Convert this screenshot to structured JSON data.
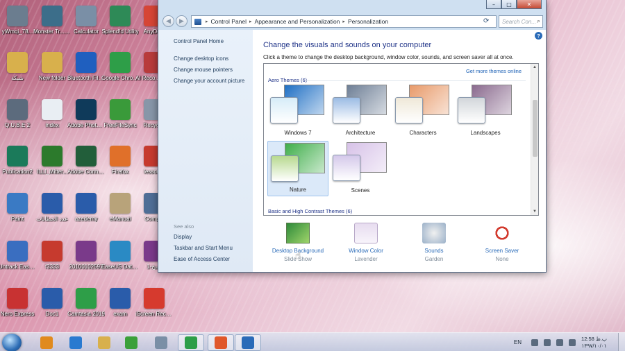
{
  "desktop_icons": [
    {
      "label": "yWmqi_78...",
      "icon": "file-icon",
      "color": "#6b7d8f"
    },
    {
      "label": "Monster Tr... - Shortcut",
      "icon": "monster-truck-icon",
      "color": "#3c6e8a"
    },
    {
      "label": "Calculator",
      "icon": "calculator-icon",
      "color": "#7a8fa6"
    },
    {
      "label": "Splend!d Utility",
      "icon": "splendid-utility-icon",
      "color": "#2e8a57"
    },
    {
      "label": "AnyDe...",
      "icon": "anydesk-icon",
      "color": "#d64536"
    },
    {
      "label": "شبكة",
      "icon": "folder-icon",
      "color": "#d8b04c"
    },
    {
      "label": "New folder",
      "icon": "folder-icon",
      "color": "#d8b04c"
    },
    {
      "label": "Bluetooth File Transf...",
      "icon": "bluetooth-icon",
      "color": "#1f5fbf"
    },
    {
      "label": "Google Chrome",
      "icon": "chrome-icon",
      "color": "#2e9e48"
    },
    {
      "label": "AI Reco... Burn",
      "icon": "recorder-icon",
      "color": "#b83b3b"
    },
    {
      "label": "Q.U.B.E 2",
      "icon": "qube-icon",
      "color": "#5c6b7d"
    },
    {
      "label": "index",
      "icon": "document-icon",
      "color": "#e9eef3"
    },
    {
      "label": "Adobe Photosh...",
      "icon": "photoshop-icon",
      "color": "#0f3a5a"
    },
    {
      "label": "FreeFileSync",
      "icon": "freefilesync-icon",
      "color": "#3a9a3a"
    },
    {
      "label": "Recycl...",
      "icon": "recycle-bin-icon",
      "color": "#8796a8"
    },
    {
      "label": "Publication2",
      "icon": "publisher-icon",
      "color": "#1b7a5a"
    },
    {
      "label": "ILLI_Mitter...",
      "icon": "app-icon",
      "color": "#2c7a2c"
    },
    {
      "label": "Adobe Connect",
      "icon": "adobe-connect-icon",
      "color": "#225e3a"
    },
    {
      "label": "Firefox",
      "icon": "firefox-icon",
      "color": "#e0702a"
    },
    {
      "label": "lesson...",
      "icon": "pdf-icon",
      "color": "#c63a2e"
    },
    {
      "label": "Paint",
      "icon": "paint-icon",
      "color": "#3a7ac4"
    },
    {
      "label": "عدد الخطابات",
      "icon": "word-doc-icon",
      "color": "#2a5caa"
    },
    {
      "label": "azedemy",
      "icon": "word-doc-icon",
      "color": "#2a5caa"
    },
    {
      "label": "eManual",
      "icon": "manual-icon",
      "color": "#b8a37a"
    },
    {
      "label": "Comp...",
      "icon": "computer-icon",
      "color": "#4f6e96"
    },
    {
      "label": "Untrack Easy Recovery",
      "icon": "recovery-icon",
      "color": "#3a6ec0"
    },
    {
      "label": "f3333",
      "icon": "pdf-icon",
      "color": "#c63a2e"
    },
    {
      "label": "20100102597",
      "icon": "winrar-icon",
      "color": "#7a3a8a"
    },
    {
      "label": "EaseUS Data Recovery...",
      "icon": "easeus-icon",
      "color": "#2a8ac4"
    },
    {
      "label": "نسخ-1",
      "icon": "winrar-icon",
      "color": "#7a3a8a"
    },
    {
      "label": "Nero Express",
      "icon": "nero-icon",
      "color": "#c83232"
    },
    {
      "label": "Doc1",
      "icon": "word-doc-icon",
      "color": "#2a5caa"
    },
    {
      "label": "Camtasia 2019",
      "icon": "camtasia-icon",
      "color": "#2e9e48"
    },
    {
      "label": "exam",
      "icon": "word-doc-icon",
      "color": "#2a5caa"
    },
    {
      "label": "iScreen Recorder",
      "icon": "screen-recorder-icon",
      "color": "#d63a2e"
    }
  ],
  "window": {
    "breadcrumb": [
      "Control Panel",
      "Appearance and Personalization",
      "Personalization"
    ],
    "search_placeholder": "Search Con...",
    "buttons": {
      "minimize": "–",
      "maximize": "□",
      "close": "✕"
    }
  },
  "left_pane": {
    "home": "Control Panel Home",
    "links": [
      "Change desktop icons",
      "Change mouse pointers",
      "Change your account picture"
    ],
    "see_also_label": "See also",
    "see_also": [
      "Display",
      "Taskbar and Start Menu",
      "Ease of Access Center"
    ]
  },
  "main": {
    "title": "Change the visuals and sounds on your computer",
    "subtitle": "Click a theme to change the desktop background, window color, sounds, and screen saver all at once.",
    "get_more": "Get more themes online",
    "group_aero": "Aero Themes (6)",
    "group_basic": "Basic and High Contrast Themes (6)",
    "themes": [
      {
        "name": "Windows 7",
        "bg": "#1f6fc4",
        "sw": "#d6ecf8",
        "selected": false
      },
      {
        "name": "Architecture",
        "bg": "#6e7f96",
        "sw": "#9bbbe4",
        "selected": false
      },
      {
        "name": "Characters",
        "bg": "#e89a6a",
        "sw": "#efe8d8",
        "selected": false
      },
      {
        "name": "Landscapes",
        "bg": "#8a6a8e",
        "sw": "#d2d6da",
        "selected": false
      },
      {
        "name": "Nature",
        "bg": "#3fae4a",
        "sw": "#b7d98f",
        "selected": true
      },
      {
        "name": "Scenes",
        "bg": "#d7c2e8",
        "sw": "#d4c8ea",
        "selected": false
      }
    ]
  },
  "bottom": [
    {
      "label": "Desktop Background",
      "sub": "Slide Show",
      "icon": "desktop-background-icon"
    },
    {
      "label": "Window Color",
      "sub": "Lavender",
      "icon": "window-color-icon"
    },
    {
      "label": "Sounds",
      "sub": "Garden",
      "icon": "sounds-icon"
    },
    {
      "label": "Screen Saver",
      "sub": "None",
      "icon": "screen-saver-icon"
    }
  ],
  "taskbar": {
    "apps": [
      {
        "icon": "media-player-icon",
        "color": "#e08a1e",
        "active": false
      },
      {
        "icon": "internet-explorer-icon",
        "color": "#2a7ad0",
        "active": false
      },
      {
        "icon": "file-explorer-icon",
        "color": "#d8b04c",
        "active": false
      },
      {
        "icon": "parrot-icon",
        "color": "#3aa03a",
        "active": false
      },
      {
        "icon": "calculator-icon",
        "color": "#7a8fa6",
        "active": false
      },
      {
        "icon": "camtasia-icon",
        "color": "#2e9e48",
        "active": true
      },
      {
        "icon": "camtasia-recorder-icon",
        "color": "#e0572a",
        "active": true
      },
      {
        "icon": "control-panel-icon",
        "color": "#2a6bb8",
        "active": true
      }
    ],
    "language": "EN",
    "time": "12:58 ب.ظ",
    "date": "۱۳۹۷/۱۰/۰۱"
  }
}
